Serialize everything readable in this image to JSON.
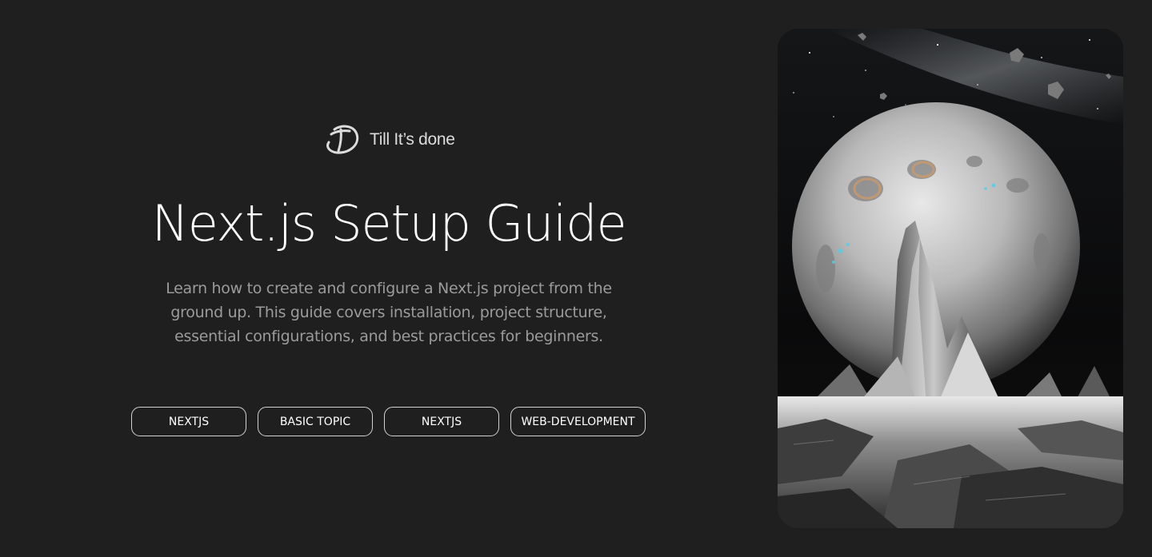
{
  "brand": {
    "name": "Till It’s done",
    "logo_icon": "td-monogram-logo"
  },
  "hero": {
    "title": "Next.js Setup Guide",
    "description": "Learn how to create and configure a Next.js project from the ground up. This guide covers installation, project structure, essential configurations, and best practices for beginners."
  },
  "tags": [
    {
      "label": "NEXTJS"
    },
    {
      "label": "BASIC TOPIC"
    },
    {
      "label": "NEXTJS"
    },
    {
      "label": "WEB-DEVELOPMENT"
    }
  ],
  "image": {
    "subject": "moon-and-rocky-peaks-illustration"
  },
  "colors": {
    "background": "#1f1f1f",
    "text": "#ffffff",
    "muted_text": "#9b9b9b",
    "tag_border": "#d2d2d2",
    "accent_glow": "#4fd0e8"
  }
}
